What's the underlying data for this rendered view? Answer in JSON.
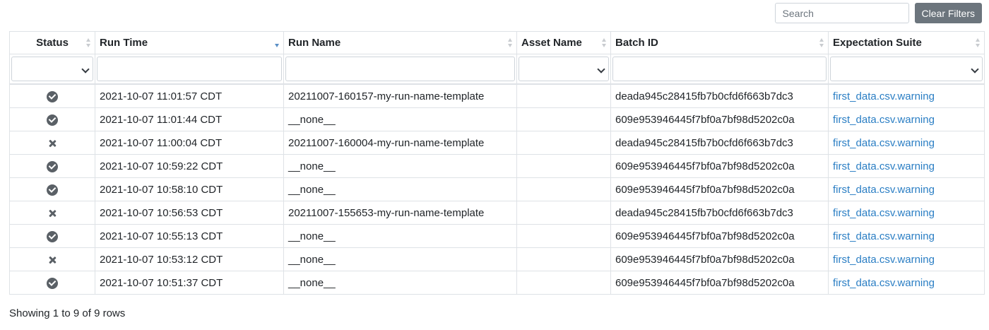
{
  "toolbar": {
    "search_placeholder": "Search",
    "clear_filters_label": "Clear Filters"
  },
  "table": {
    "columns": [
      {
        "key": "status",
        "label": "Status",
        "sort": "none",
        "filter": "select"
      },
      {
        "key": "run_time",
        "label": "Run Time",
        "sort": "desc",
        "filter": "text"
      },
      {
        "key": "run_name",
        "label": "Run Name",
        "sort": "none",
        "filter": "text"
      },
      {
        "key": "asset_name",
        "label": "Asset Name",
        "sort": "none",
        "filter": "select"
      },
      {
        "key": "batch_id",
        "label": "Batch ID",
        "sort": "none",
        "filter": "text"
      },
      {
        "key": "expectation_suite",
        "label": "Expectation Suite",
        "sort": "none",
        "filter": "select"
      }
    ],
    "rows": [
      {
        "status": "success",
        "run_time": "2021-10-07 11:01:57 CDT",
        "run_name": "20211007-160157-my-run-name-template",
        "asset_name": "",
        "batch_id": "deada945c28415fb7b0cfd6f663b7dc3",
        "expectation_suite": "first_data.csv.warning"
      },
      {
        "status": "success",
        "run_time": "2021-10-07 11:01:44 CDT",
        "run_name": "__none__",
        "asset_name": "",
        "batch_id": "609e953946445f7bf0a7bf98d5202c0a",
        "expectation_suite": "first_data.csv.warning"
      },
      {
        "status": "failed",
        "run_time": "2021-10-07 11:00:04 CDT",
        "run_name": "20211007-160004-my-run-name-template",
        "asset_name": "",
        "batch_id": "deada945c28415fb7b0cfd6f663b7dc3",
        "expectation_suite": "first_data.csv.warning"
      },
      {
        "status": "success",
        "run_time": "2021-10-07 10:59:22 CDT",
        "run_name": "__none__",
        "asset_name": "",
        "batch_id": "609e953946445f7bf0a7bf98d5202c0a",
        "expectation_suite": "first_data.csv.warning"
      },
      {
        "status": "success",
        "run_time": "2021-10-07 10:58:10 CDT",
        "run_name": "__none__",
        "asset_name": "",
        "batch_id": "609e953946445f7bf0a7bf98d5202c0a",
        "expectation_suite": "first_data.csv.warning"
      },
      {
        "status": "failed",
        "run_time": "2021-10-07 10:56:53 CDT",
        "run_name": "20211007-155653-my-run-name-template",
        "asset_name": "",
        "batch_id": "deada945c28415fb7b0cfd6f663b7dc3",
        "expectation_suite": "first_data.csv.warning"
      },
      {
        "status": "success",
        "run_time": "2021-10-07 10:55:13 CDT",
        "run_name": "__none__",
        "asset_name": "",
        "batch_id": "609e953946445f7bf0a7bf98d5202c0a",
        "expectation_suite": "first_data.csv.warning"
      },
      {
        "status": "failed",
        "run_time": "2021-10-07 10:53:12 CDT",
        "run_name": "__none__",
        "asset_name": "",
        "batch_id": "609e953946445f7bf0a7bf98d5202c0a",
        "expectation_suite": "first_data.csv.warning"
      },
      {
        "status": "success",
        "run_time": "2021-10-07 10:51:37 CDT",
        "run_name": "__none__",
        "asset_name": "",
        "batch_id": "609e953946445f7bf0a7bf98d5202c0a",
        "expectation_suite": "first_data.csv.warning"
      }
    ]
  },
  "pagination": {
    "summary": "Showing 1 to 9 of 9 rows"
  },
  "icons": {
    "success": "check-circle-icon",
    "failed": "x-icon",
    "sort_desc": "sort-desc-icon",
    "sort_none": "sort-both-icon",
    "select": "chevron-down-icon"
  },
  "colors": {
    "link": "#2a7ec4",
    "button": "#6c757d",
    "status_icon": "#5a6066",
    "sort_active": "#5a8fc6"
  }
}
